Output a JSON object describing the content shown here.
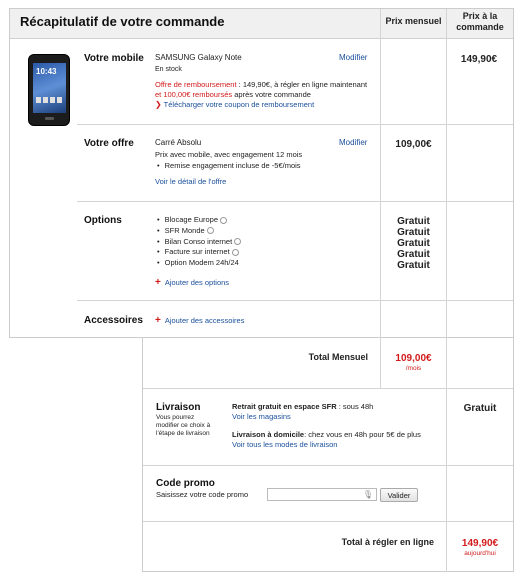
{
  "header": {
    "title": "Récapitulatif de votre commande",
    "col_monthly": "Prix mensuel",
    "col_order": "Prix à la commande"
  },
  "mobile": {
    "label": "Votre mobile",
    "name": "SAMSUNG Galaxy Note",
    "stock": "En stock",
    "refund_prefix": "Offre de remboursement",
    "refund_text": " : 149,90€, à régler en ligne maintenant",
    "refund_line2_amount": "et 100,00€ remboursés",
    "refund_line2_rest": " après votre commande",
    "coupon_link": "Télécharger votre coupon de remboursement",
    "modify": "Modifier",
    "phone_time": "10:43",
    "price_order": "149,90€"
  },
  "offer": {
    "label": "Votre offre",
    "name": "Carré Absolu",
    "line1": "Prix avec mobile, avec engagement 12 mois",
    "line2": "Remise engagement incluse de -5€/mois",
    "detail_link": "Voir le détail de l'offre",
    "modify": "Modifier",
    "price_monthly": "109,00€"
  },
  "options": {
    "label": "Options",
    "items": [
      {
        "label": "Blocage Europe",
        "price": "Gratuit"
      },
      {
        "label": "SFR Monde",
        "price": "Gratuit"
      },
      {
        "label": "Bilan Conso internet",
        "price": "Gratuit"
      },
      {
        "label": "Facture sur internet",
        "price": "Gratuit"
      },
      {
        "label": "Option Modem 24h/24",
        "price": "Gratuit"
      }
    ],
    "add_link": "Ajouter des options"
  },
  "accessories": {
    "label": "Accessoires",
    "add_link": "Ajouter des accessoires"
  },
  "total_monthly": {
    "label": "Total Mensuel",
    "value": "109,00€",
    "unit": "/mois"
  },
  "delivery": {
    "label": "Livraison",
    "note_lines": [
      "Vous pourrez",
      "modifier ce choix à",
      "l'étape de livraison"
    ],
    "option1_bold": "Retrait gratuit en espace SFR",
    "option1_rest": " : sous 48h",
    "option1_link": "Voir les magasins",
    "option2_bold": "Livraison à domicile",
    "option2_rest": ": chez vous en 48h pour 5€ de plus",
    "option2_link": "Voir tous les modes de livraison",
    "price": "Gratuit"
  },
  "promo": {
    "label": "Code promo",
    "prompt": "Saisissez votre code promo",
    "input_value": "",
    "button": "Valider"
  },
  "total_online": {
    "label": "Total à régler en ligne",
    "value": "149,90€",
    "unit": "aujourd'hui"
  },
  "colors": {
    "accent_red": "#d21a1a",
    "link_blue": "#1a4f9c",
    "border": "#d4d4d4",
    "header_bg": "#f0f0f0"
  }
}
